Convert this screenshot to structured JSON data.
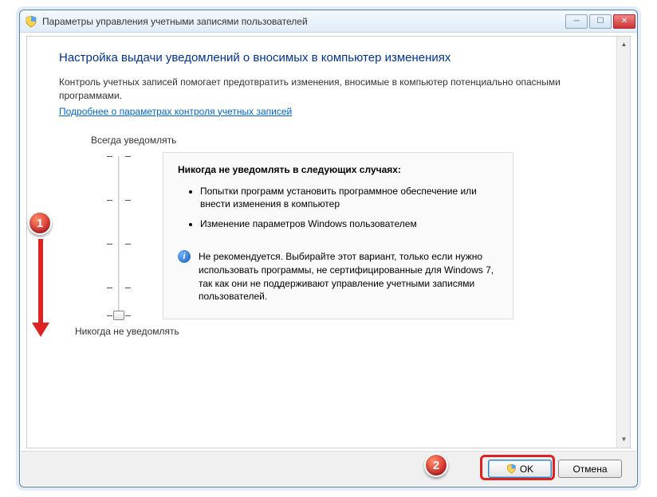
{
  "window": {
    "title": "Параметры управления учетными записями пользователей"
  },
  "content": {
    "heading": "Настройка выдачи уведомлений о вносимых в компьютер изменениях",
    "intro": "Контроль учетных записей помогает предотвратить изменения, вносимые в компьютер потенциально опасными программами.",
    "link": "Подробнее о параметрах контроля учетных записей",
    "slider_top": "Всегда уведомлять",
    "slider_bottom": "Никогда не уведомлять"
  },
  "panel": {
    "title": "Никогда не уведомлять в следующих случаях:",
    "items": [
      "Попытки программ установить программное обеспечение или внести изменения в компьютер",
      "Изменение параметров Windows пользователем"
    ],
    "note": "Не рекомендуется. Выбирайте этот вариант, только если нужно использовать программы, не сертифицированные для Windows 7, так как они не поддерживают управление учетными записями пользователей."
  },
  "buttons": {
    "ok": "OK",
    "cancel": "Отмена"
  },
  "annotations": {
    "step1": "1",
    "step2": "2"
  }
}
